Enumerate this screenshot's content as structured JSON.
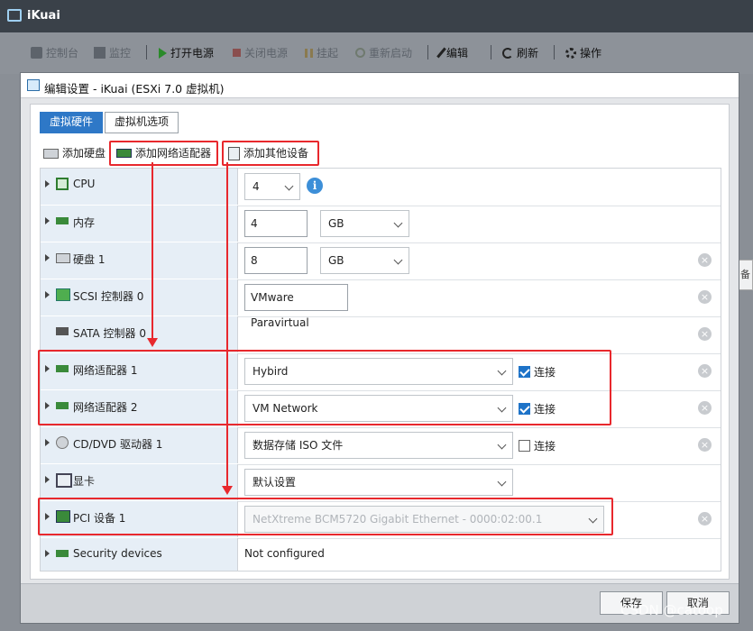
{
  "app": {
    "title": "iKuai"
  },
  "toolbar": {
    "items": [
      {
        "label": "控制台",
        "state": "disabled"
      },
      {
        "label": "监控",
        "state": "disabled"
      },
      {
        "label": "打开电源",
        "state": "enabled"
      },
      {
        "label": "关闭电源",
        "state": "disabled"
      },
      {
        "label": "挂起",
        "state": "disabled"
      },
      {
        "label": "重新启动",
        "state": "disabled"
      },
      {
        "label": "编辑",
        "state": "enabled"
      },
      {
        "label": "刷新",
        "state": "enabled"
      },
      {
        "label": "操作",
        "state": "enabled"
      }
    ]
  },
  "dialog": {
    "title": "编辑设置 - iKuai (ESXi 7.0 虚拟机)",
    "tabs": [
      {
        "label": "虚拟硬件",
        "active": true
      },
      {
        "label": "虚拟机选项",
        "active": false
      }
    ],
    "add_buttons": {
      "add_disk": "添加硬盘",
      "add_nic": "添加网络适配器",
      "add_other": "添加其他设备"
    },
    "devices": {
      "cpu": {
        "label": "CPU",
        "value": "4"
      },
      "memory": {
        "label": "内存",
        "value": "4",
        "unit": "GB"
      },
      "disk": {
        "label": "硬盘 1",
        "value": "8",
        "unit": "GB"
      },
      "scsi": {
        "label": "SCSI 控制器 0",
        "value": "VMware Paravirtual"
      },
      "sata": {
        "label": "SATA 控制器 0"
      },
      "nic1": {
        "label": "网络适配器 1",
        "network": "Hybird",
        "connect_label": "连接",
        "connected": true
      },
      "nic2": {
        "label": "网络适配器 2",
        "network": "VM Network",
        "connect_label": "连接",
        "connected": true
      },
      "cdrom": {
        "label": "CD/DVD 驱动器 1",
        "value": "数据存储 ISO 文件",
        "connect_label": "连接",
        "connected": false
      },
      "video": {
        "label": "显卡",
        "value": "默认设置"
      },
      "pci": {
        "label": "PCI 设备 1",
        "value": "NetXtreme BCM5720 Gigabit Ethernet - 0000:02:00.1"
      },
      "security": {
        "label": "Security devices",
        "value": "Not configured"
      }
    },
    "footer": {
      "save": "保存",
      "cancel": "取消"
    }
  },
  "side_tab": "备",
  "watermark": "CSDN @catoop",
  "colors": {
    "accent": "#2e78c7",
    "annotation_red": "#e8282d"
  }
}
